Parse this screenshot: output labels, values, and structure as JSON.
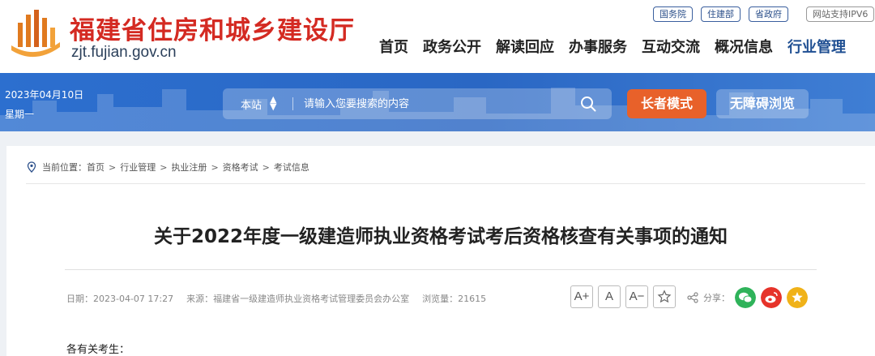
{
  "header": {
    "site_name": "福建省住房和城乡建设厅",
    "domain": "zjt.fujian.gov.cn",
    "top_links": [
      "国务院",
      "住建部",
      "省政府"
    ],
    "ipv6_label": "网站支持IPV6",
    "nav": [
      "首页",
      "政务公开",
      "解读回应",
      "办事服务",
      "互动交流",
      "概况信息",
      "行业管理"
    ],
    "active_nav": "行业管理"
  },
  "banner": {
    "date": "2023年04月10日",
    "weekday": "星期一",
    "search_scope": "本站",
    "search_placeholder": "请输入您要搜索的内容",
    "elder_mode": "长者模式",
    "accessible": "无障碍浏览"
  },
  "breadcrumb": {
    "prefix": "当前位置：",
    "items": [
      "首页",
      "行业管理",
      "执业注册",
      "资格考试",
      "考试信息"
    ]
  },
  "article": {
    "title": "关于2022年度一级建造师执业资格考试考后资格核查有关事项的通知",
    "date": "日期：2023-04-07 17:27",
    "source": "来源：福建省一级建造师执业资格考试管理委员会办公室",
    "views": "浏览量：21615",
    "font_tools": [
      "A+",
      "A",
      "A−"
    ],
    "share_label": "分享：",
    "greeting": "各有关考生："
  },
  "colors": {
    "brand_red": "#d42a22",
    "banner_blue": "#2c6fcf",
    "elder_orange": "#e8612a",
    "wechat_green": "#2fb35a",
    "weibo_red": "#e6332a",
    "fav_yellow": "#f0b219"
  }
}
